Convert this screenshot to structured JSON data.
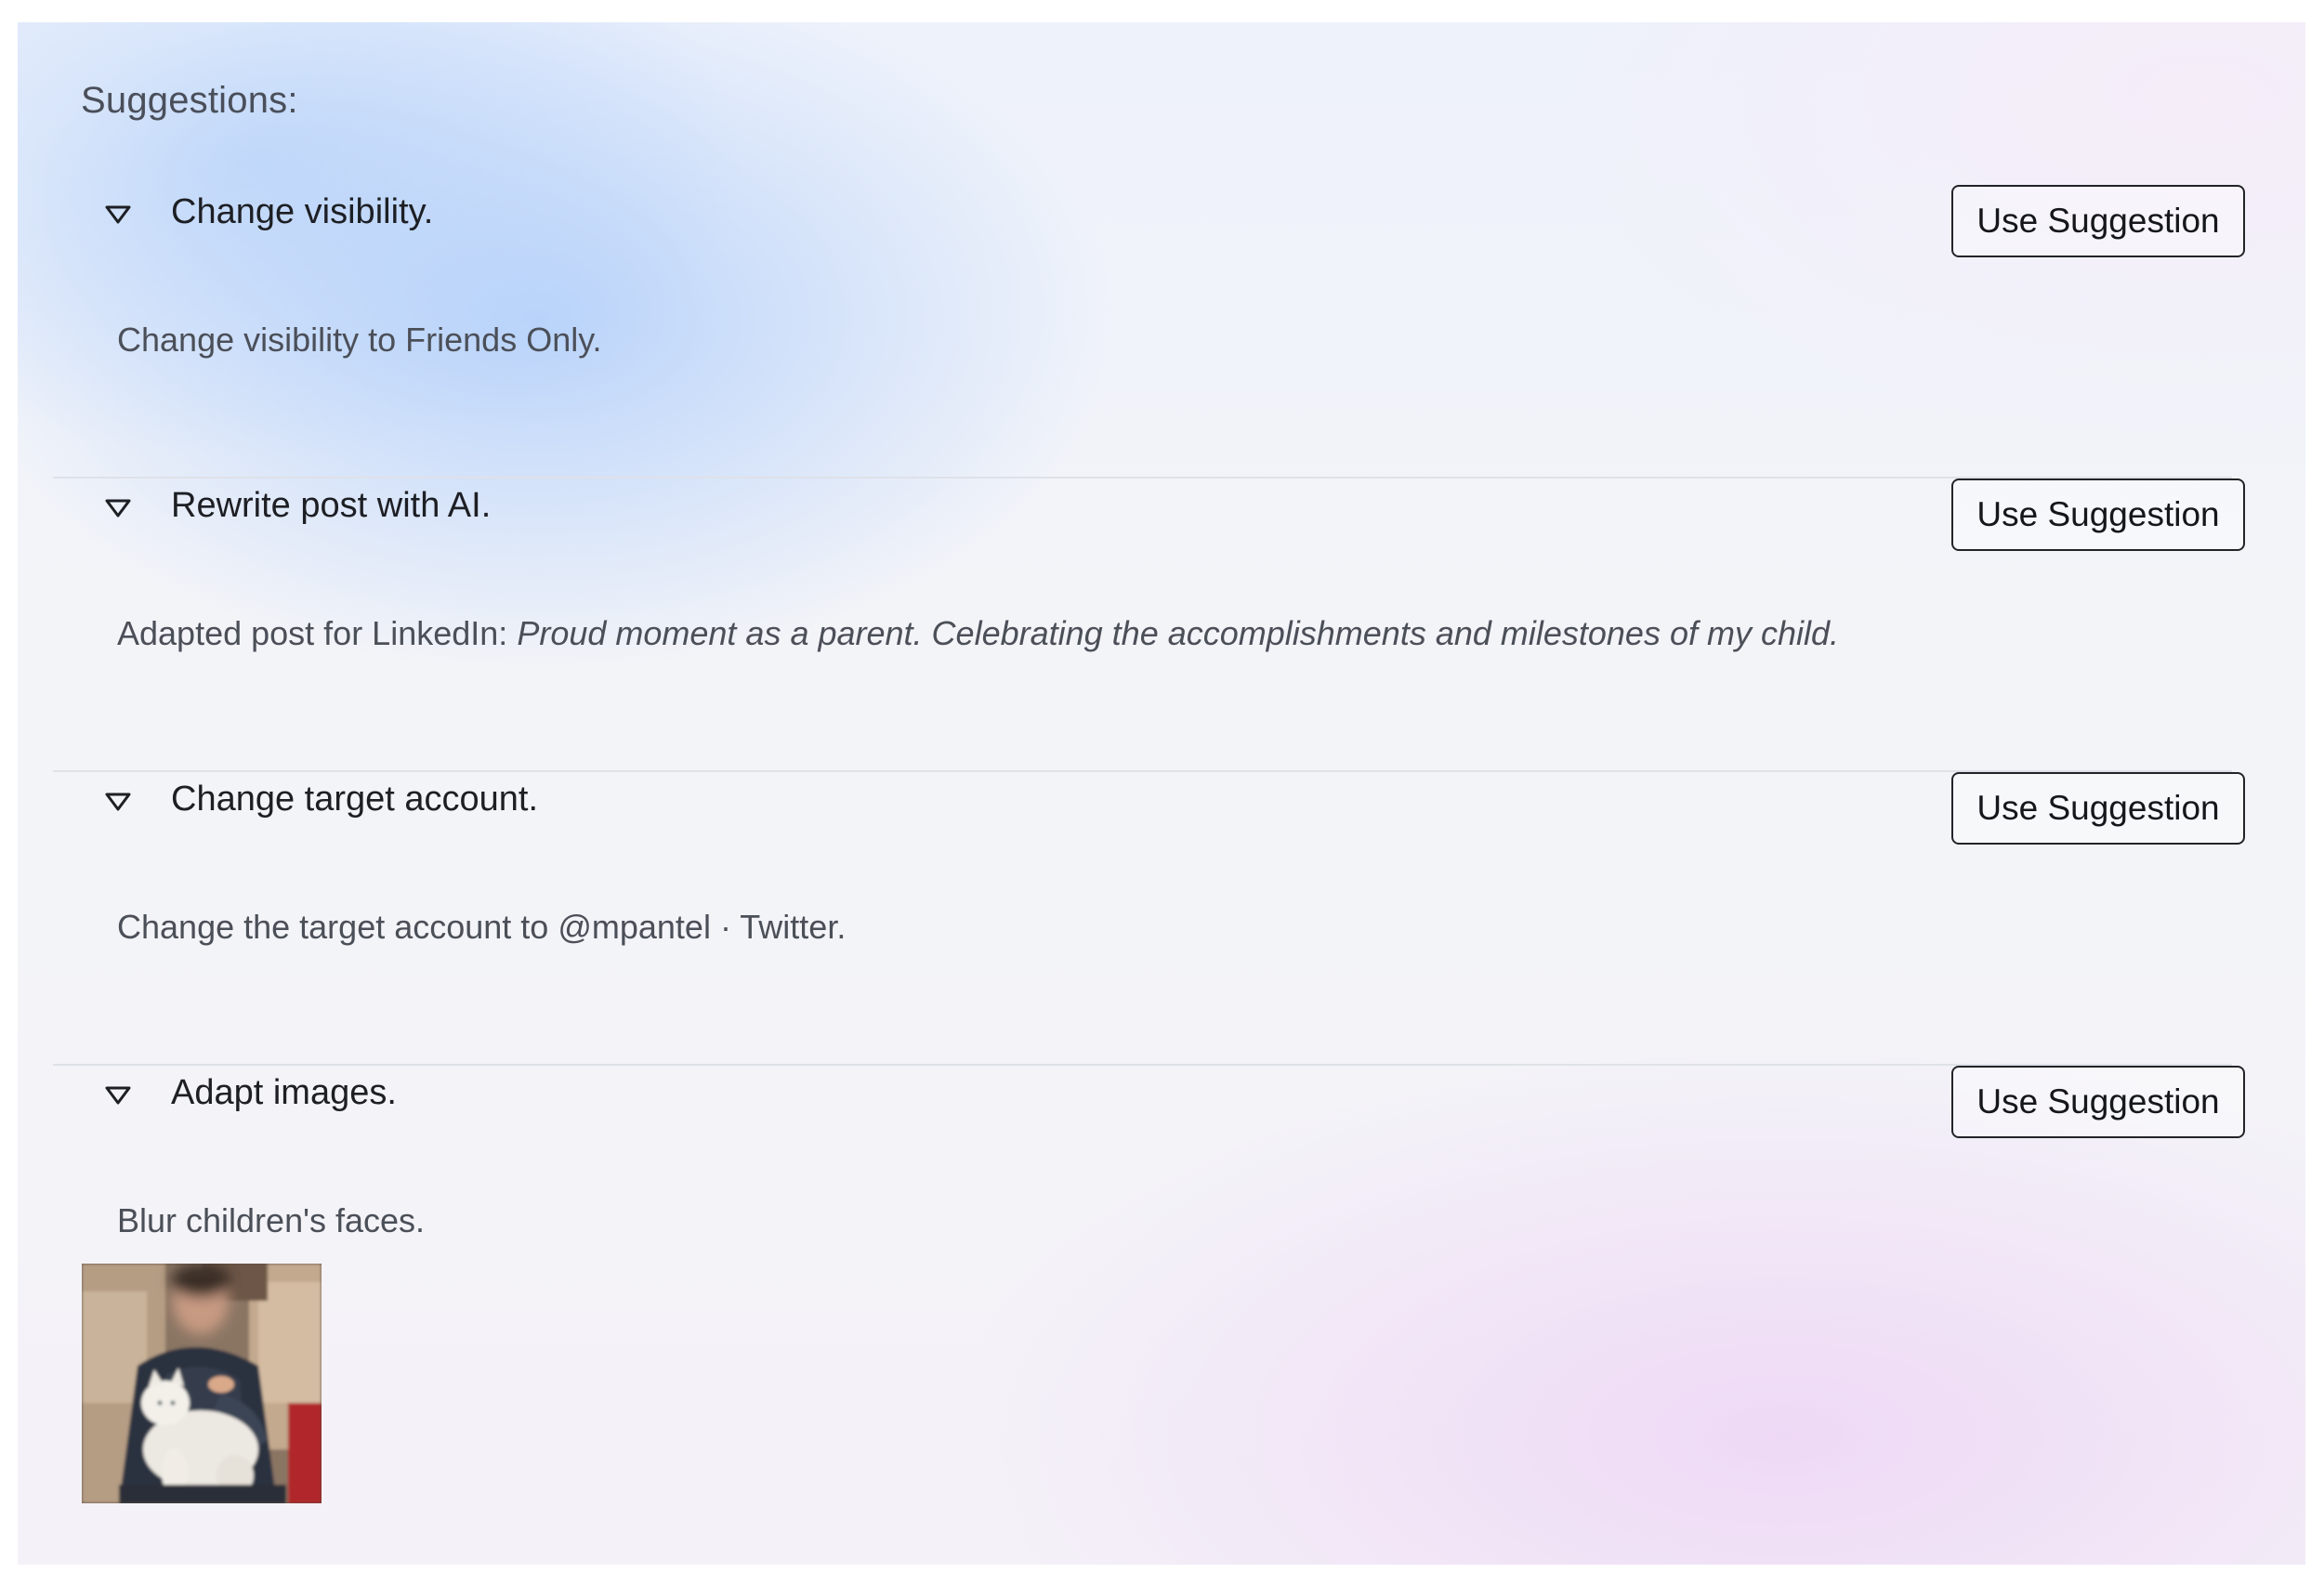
{
  "heading": "Suggestions:",
  "suggestions": [
    {
      "title": "Change visibility.",
      "button_label": "Use Suggestion",
      "description": "Change visibility to Friends Only.",
      "toggle_icon": "triangle-down-outline"
    },
    {
      "title": "Rewrite post with AI.",
      "button_label": "Use Suggestion",
      "description_prefix": "Adapted post for LinkedIn:",
      "description_italic": "Proud moment as a parent. Celebrating the accomplishments and milestones of my child.",
      "toggle_icon": "triangle-down-outline"
    },
    {
      "title": "Change target account.",
      "button_label": "Use Suggestion",
      "description": "Change the target account to @mpantel · Twitter.",
      "toggle_icon": "triangle-down-outline"
    },
    {
      "title": "Adapt images.",
      "button_label": "Use Suggestion",
      "description": "Blur children's faces.",
      "toggle_icon": "triangle-down-outline",
      "image": "person-holding-white-cat-blurred-face"
    }
  ],
  "colors": {
    "text_primary": "#1d1f24",
    "text_secondary": "#4b4f58",
    "divider": "#dfe1e8",
    "button_border": "#222428"
  }
}
